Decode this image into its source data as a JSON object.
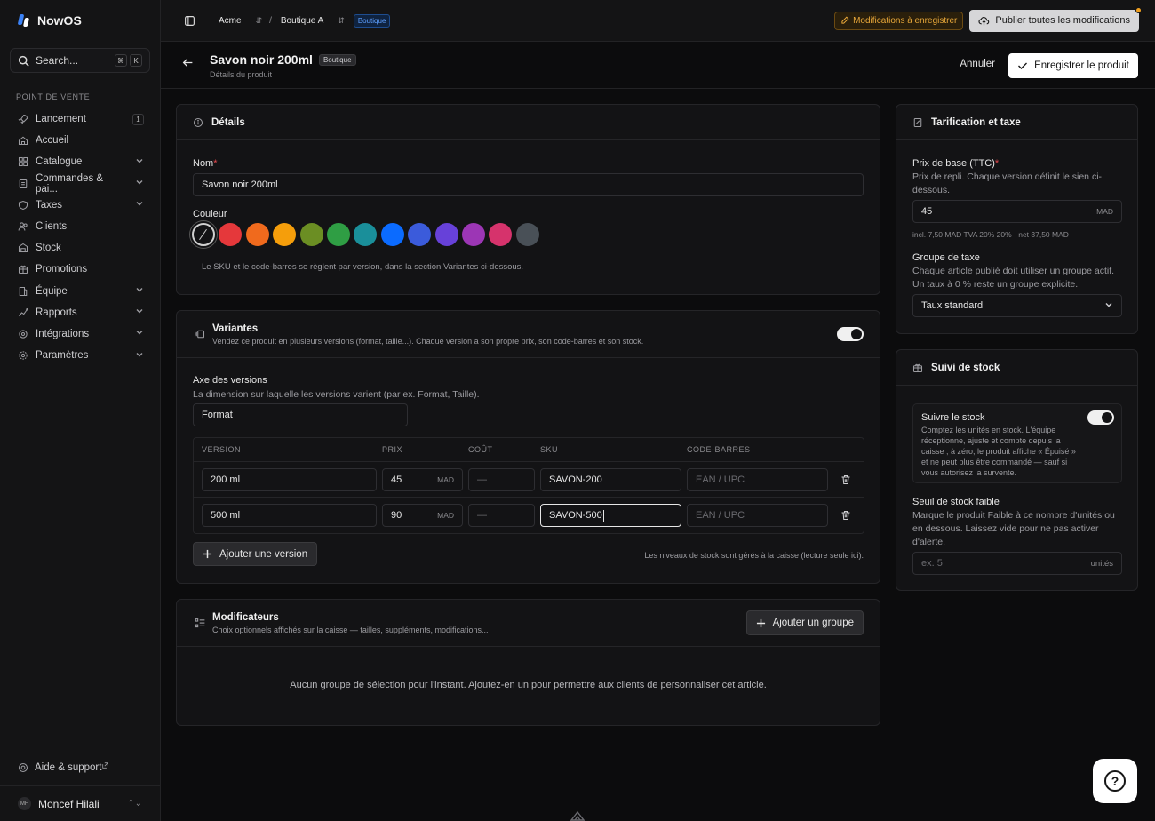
{
  "sidebar": {
    "brand": "NowOS",
    "search": {
      "label": "Search...",
      "kbd1": "⌘",
      "kbd2": "K"
    },
    "section_label": "POINT DE VENTE",
    "items": [
      {
        "label": "Lancement",
        "icon": "rocket-icon",
        "badge": "1"
      },
      {
        "label": "Accueil",
        "icon": "home-icon"
      },
      {
        "label": "Catalogue",
        "icon": "grid-icon",
        "expandable": true
      },
      {
        "label": "Commandes & pai...",
        "icon": "receipt-icon",
        "expandable": true
      },
      {
        "label": "Taxes",
        "icon": "percent-icon",
        "expandable": true
      },
      {
        "label": "Clients",
        "icon": "users-icon"
      },
      {
        "label": "Stock",
        "icon": "warehouse-icon"
      },
      {
        "label": "Promotions",
        "icon": "tag-icon"
      },
      {
        "label": "Équipe",
        "icon": "team-icon",
        "expandable": true
      },
      {
        "label": "Rapports",
        "icon": "chart-icon",
        "expandable": true
      },
      {
        "label": "Intégrations",
        "icon": "plug-icon",
        "expandable": true
      },
      {
        "label": "Paramètres",
        "icon": "gear-icon",
        "expandable": true
      }
    ],
    "help_label": "Aide & support",
    "user": {
      "initials": "MH",
      "name": "Moncef Hilali"
    }
  },
  "topbar": {
    "org": "Acme",
    "separator": "/",
    "store": "Boutique A",
    "store_badge": "Boutique",
    "pending_label": "Modifications à enregistrer",
    "publish_label": "Publier toutes les modifications"
  },
  "header": {
    "title": "Savon noir 200ml",
    "title_badge": "Boutique",
    "subtitle": "Détails du produit",
    "cancel_label": "Annuler",
    "save_label": "Enregistrer le produit"
  },
  "details": {
    "title": "Détails",
    "name_label": "Nom",
    "name_value": "Savon noir 200ml",
    "color_label": "Couleur",
    "colors": [
      "none",
      "#e5383b",
      "#f06a1d",
      "#f59e0b",
      "#6b8e23",
      "#2f9e44",
      "#1a8f9a",
      "#0b6bff",
      "#3b5bdb",
      "#6741d9",
      "#9c36b5",
      "#d6336c",
      "#495057"
    ],
    "note": "Le SKU et le code-barres se règlent par version, dans la section Variantes ci-dessous."
  },
  "variants": {
    "title": "Variantes",
    "description": "Vendez ce produit en plusieurs versions (format, taille...). Chaque version a son propre prix, son code-barres et son stock.",
    "enabled": true,
    "axis_label": "Axe des versions",
    "axis_help": "La dimension sur laquelle les versions varient (par ex. Format, Taille).",
    "axis_value": "Format",
    "columns": [
      "VERSION",
      "PRIX",
      "COÛT",
      "SKU",
      "CODE-BARRES"
    ],
    "rows": [
      {
        "version": "200 ml",
        "price": "45",
        "currency": "MAD",
        "cost": "—",
        "sku": "SAVON-200",
        "barcode_placeholder": "EAN / UPC"
      },
      {
        "version": "500 ml",
        "price": "90",
        "currency": "MAD",
        "cost": "—",
        "sku": "SAVON-500",
        "barcode_placeholder": "EAN / UPC"
      }
    ],
    "add_label": "Ajouter une version",
    "footer_note": "Les niveaux de stock sont gérés à la caisse (lecture seule ici)."
  },
  "modifiers": {
    "title": "Modificateurs",
    "description": "Choix optionnels affichés sur la caisse — tailles, suppléments, modifications...",
    "add_label": "Ajouter un groupe",
    "empty": "Aucun groupe de sélection pour l'instant. Ajoutez-en un pour permettre aux clients de personnaliser cet article."
  },
  "pricing": {
    "title": "Tarification et taxe",
    "base_label": "Prix de base (TTC)",
    "base_help": "Prix de repli. Chaque version définit le sien ci-dessous.",
    "base_value": "45",
    "base_currency": "MAD",
    "base_breakdown": "incl. 7,50 MAD TVA 20% 20% · net 37,50 MAD",
    "tax_label": "Groupe de taxe",
    "tax_help": "Chaque article publié doit utiliser un groupe actif. Un taux à 0 % reste un groupe explicite.",
    "tax_value": "Taux standard"
  },
  "stock": {
    "title": "Suivi de stock",
    "track_label": "Suivre le stock",
    "track_enabled": true,
    "track_help": "Comptez les unités en stock. L'équipe réceptionne, ajuste et compte depuis la caisse ; à zéro, le produit affiche « Épuisé » et ne peut plus être commandé — sauf si vous autorisez la survente.",
    "low_label": "Seuil de stock faible",
    "low_help": "Marque le produit Faible à ce nombre d'unités ou en dessous. Laissez vide pour ne pas activer d'alerte.",
    "low_placeholder": "ex. 5",
    "low_unit": "unités"
  }
}
